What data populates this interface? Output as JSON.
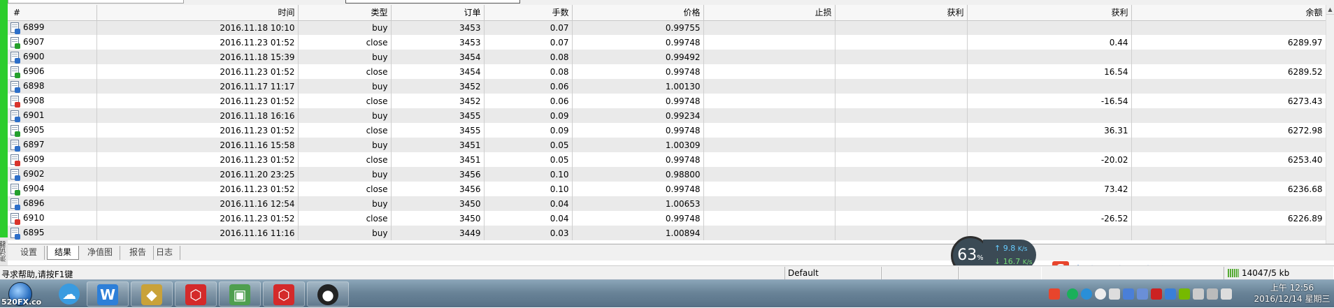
{
  "columns": [
    "#",
    "时间",
    "类型",
    "订单",
    "手数",
    "价格",
    "止损",
    "获利",
    "获利",
    "余额"
  ],
  "rows": [
    {
      "id": "6899",
      "time": "2016.11.18 10:10",
      "type": "buy",
      "order": "3453",
      "lots": "0.07",
      "price": "0.99755",
      "sl": "",
      "tp": "",
      "profit": "",
      "balance": "",
      "icon": "buy"
    },
    {
      "id": "6907",
      "time": "2016.11.23 01:52",
      "type": "close",
      "order": "3453",
      "lots": "0.07",
      "price": "0.99748",
      "sl": "",
      "tp": "",
      "profit": "0.44",
      "balance": "6289.97",
      "icon": "close-up"
    },
    {
      "id": "6900",
      "time": "2016.11.18 15:39",
      "type": "buy",
      "order": "3454",
      "lots": "0.08",
      "price": "0.99492",
      "sl": "",
      "tp": "",
      "profit": "",
      "balance": "",
      "icon": "buy"
    },
    {
      "id": "6906",
      "time": "2016.11.23 01:52",
      "type": "close",
      "order": "3454",
      "lots": "0.08",
      "price": "0.99748",
      "sl": "",
      "tp": "",
      "profit": "16.54",
      "balance": "6289.52",
      "icon": "close-up"
    },
    {
      "id": "6898",
      "time": "2016.11.17 11:17",
      "type": "buy",
      "order": "3452",
      "lots": "0.06",
      "price": "1.00130",
      "sl": "",
      "tp": "",
      "profit": "",
      "balance": "",
      "icon": "buy"
    },
    {
      "id": "6908",
      "time": "2016.11.23 01:52",
      "type": "close",
      "order": "3452",
      "lots": "0.06",
      "price": "0.99748",
      "sl": "",
      "tp": "",
      "profit": "-16.54",
      "balance": "6273.43",
      "icon": "close-down"
    },
    {
      "id": "6901",
      "time": "2016.11.18 16:16",
      "type": "buy",
      "order": "3455",
      "lots": "0.09",
      "price": "0.99234",
      "sl": "",
      "tp": "",
      "profit": "",
      "balance": "",
      "icon": "buy"
    },
    {
      "id": "6905",
      "time": "2016.11.23 01:52",
      "type": "close",
      "order": "3455",
      "lots": "0.09",
      "price": "0.99748",
      "sl": "",
      "tp": "",
      "profit": "36.31",
      "balance": "6272.98",
      "icon": "close-up"
    },
    {
      "id": "6897",
      "time": "2016.11.16 15:58",
      "type": "buy",
      "order": "3451",
      "lots": "0.05",
      "price": "1.00309",
      "sl": "",
      "tp": "",
      "profit": "",
      "balance": "",
      "icon": "buy"
    },
    {
      "id": "6909",
      "time": "2016.11.23 01:52",
      "type": "close",
      "order": "3451",
      "lots": "0.05",
      "price": "0.99748",
      "sl": "",
      "tp": "",
      "profit": "-20.02",
      "balance": "6253.40",
      "icon": "close-down"
    },
    {
      "id": "6902",
      "time": "2016.11.20 23:25",
      "type": "buy",
      "order": "3456",
      "lots": "0.10",
      "price": "0.98800",
      "sl": "",
      "tp": "",
      "profit": "",
      "balance": "",
      "icon": "buy"
    },
    {
      "id": "6904",
      "time": "2016.11.23 01:52",
      "type": "close",
      "order": "3456",
      "lots": "0.10",
      "price": "0.99748",
      "sl": "",
      "tp": "",
      "profit": "73.42",
      "balance": "6236.68",
      "icon": "close-up"
    },
    {
      "id": "6896",
      "time": "2016.11.16 12:54",
      "type": "buy",
      "order": "3450",
      "lots": "0.04",
      "price": "1.00653",
      "sl": "",
      "tp": "",
      "profit": "",
      "balance": "",
      "icon": "buy"
    },
    {
      "id": "6910",
      "time": "2016.11.23 01:52",
      "type": "close",
      "order": "3450",
      "lots": "0.04",
      "price": "0.99748",
      "sl": "",
      "tp": "",
      "profit": "-26.52",
      "balance": "6226.89",
      "icon": "close-down"
    },
    {
      "id": "6895",
      "time": "2016.11.16 11:16",
      "type": "buy",
      "order": "3449",
      "lots": "0.03",
      "price": "1.00894",
      "sl": "",
      "tp": "",
      "profit": "",
      "balance": "",
      "icon": "buy"
    }
  ],
  "tabs": [
    "设置",
    "结果",
    "净值图",
    "报告",
    "日志"
  ],
  "active_tab": 1,
  "side_label": "测试器",
  "status": {
    "help": "寻求帮助,请按F1键",
    "profile": "Default",
    "traffic": "14047/5 kb"
  },
  "net_widget": {
    "percent": "63",
    "percent_unit": "%",
    "up": "9.8",
    "down": "16.7",
    "unit": "K/s"
  },
  "watermark": "520FX.co",
  "clock": {
    "time": "上午 12:56",
    "date": "2016/12/14 星期三"
  },
  "colors": {
    "buy_marker": "#2d6fc9",
    "close_profit_marker": "#25a02c",
    "close_loss_marker": "#d9342b",
    "tester_bar": "#2ccd2c"
  }
}
